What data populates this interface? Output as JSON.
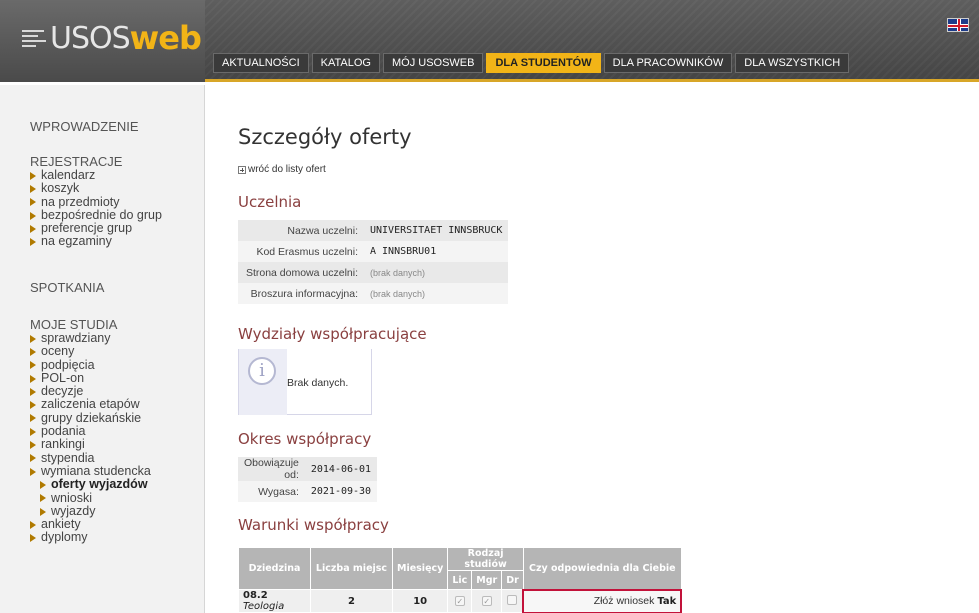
{
  "header": {
    "logo_usos": "USOS",
    "logo_web": "web",
    "menu": [
      {
        "label": "AKTUALNOŚCI"
      },
      {
        "label": "KATALOG"
      },
      {
        "label": "MÓJ USOSWEB"
      },
      {
        "label": "DLA STUDENTÓW",
        "active": true
      },
      {
        "label": "DLA PRACOWNIKÓW"
      },
      {
        "label": "DLA WSZYSTKICH"
      }
    ],
    "language_flag": "uk-flag-icon"
  },
  "sidebar": {
    "intro": "WPROWADZENIE",
    "registration": {
      "title": "REJESTRACJE",
      "items": [
        "kalendarz",
        "koszyk",
        "na przedmioty",
        "bezpośrednie do grup",
        "preferencje grup",
        "na egzaminy"
      ]
    },
    "meetings": "SPOTKANIA",
    "studies": {
      "title": "MOJE STUDIA",
      "items": [
        "sprawdziany",
        "oceny",
        "podpięcia",
        "POL-on",
        "decyzje",
        "zaliczenia etapów",
        "grupy dziekańskie",
        "podania",
        "rankingi",
        "stypendia",
        "wymiana studencka"
      ],
      "exchange_sub": [
        "oferty wyjazdów",
        "wnioski",
        "wyjazdy"
      ],
      "after": [
        "ankiety",
        "dyplomy"
      ]
    }
  },
  "main": {
    "title": "Szczegóły oferty",
    "back_link": "wróć do listy ofert",
    "university": {
      "title": "Uczelnia",
      "rows": [
        {
          "key": "Nazwa uczelni:",
          "value": "UNIVERSITAET INNSBRUCK"
        },
        {
          "key": "Kod Erasmus uczelni:",
          "value": "A INNSBRU01"
        },
        {
          "key": "Strona domowa uczelni:",
          "value": "(brak danych)"
        },
        {
          "key": "Broszura informacyjna:",
          "value": "(brak danych)"
        }
      ]
    },
    "faculties": {
      "title": "Wydziały współpracujące",
      "no_data": "Brak danych."
    },
    "period": {
      "title": "Okres współpracy",
      "rows": [
        {
          "key": "Obowiązuje od:",
          "value": "2014-06-01"
        },
        {
          "key": "Wygasa:",
          "value": "2021-09-30"
        }
      ]
    },
    "conditions": {
      "title": "Warunki współpracy",
      "headers": {
        "field": "Dziedzina",
        "places": "Liczba miejsc",
        "months": "Miesięcy",
        "study_type": "Rodzaj studiów",
        "lic": "Lic",
        "mgr": "Mgr",
        "dr": "Dr",
        "suitable": "Czy odpowiednia dla Ciebie"
      },
      "row": {
        "code": "08.2",
        "field": "Teologia",
        "places": "2",
        "months": "10",
        "lic": true,
        "mgr": true,
        "dr": false,
        "apply_link": "Złóż wniosek",
        "suitable": "Tak"
      }
    }
  }
}
